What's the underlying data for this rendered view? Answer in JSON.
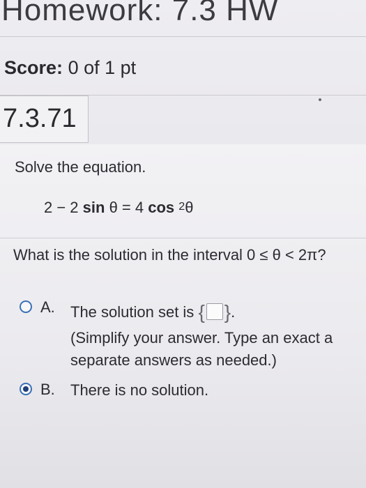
{
  "header": {
    "title": "Homework: 7.3 HW"
  },
  "score": {
    "label": "Score:",
    "value": "0 of 1 pt"
  },
  "question_id": "7.3.71",
  "question": {
    "instruction": "Solve the equation.",
    "equation": {
      "lhs": "2 − 2",
      "sin": "sin",
      "mid": " θ = 4 ",
      "cos": "cos",
      "exp": "2",
      "end": "θ"
    },
    "prompt": "What is the solution in the interval 0 ≤ θ < 2π?"
  },
  "options": [
    {
      "letter": "A.",
      "line1": "The solution set is",
      "line1_after": ".",
      "line2": "(Simplify your answer. Type an exact a",
      "line3": "separate answers as needed.)",
      "selected": false
    },
    {
      "letter": "B.",
      "line1": "There is no solution.",
      "selected": true
    }
  ],
  "colors": {
    "radio_border": "#3a70b8",
    "radio_fill_selected": "#1f3e78"
  }
}
